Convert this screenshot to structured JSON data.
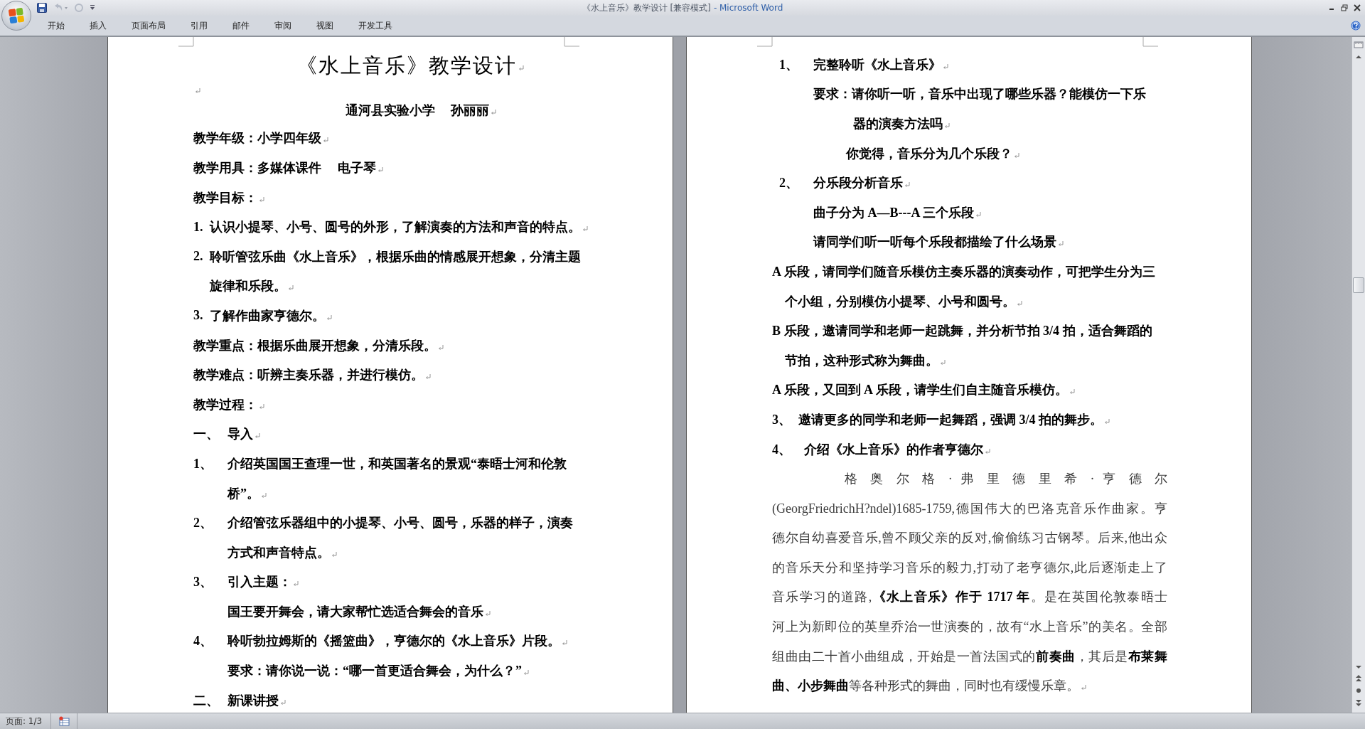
{
  "window": {
    "title": "《水上音乐》教学设计 [兼容模式]",
    "app_name": "- Microsoft Word"
  },
  "ribbon_tabs": [
    {
      "label": "开始",
      "selected": false
    },
    {
      "label": "插入",
      "selected": false
    },
    {
      "label": "页面布局",
      "selected": false
    },
    {
      "label": "引用",
      "selected": false
    },
    {
      "label": "邮件",
      "selected": false
    },
    {
      "label": "审阅",
      "selected": false
    },
    {
      "label": "视图",
      "selected": false
    },
    {
      "label": "开发工具",
      "selected": false
    }
  ],
  "pages": [
    {
      "lines": [
        {
          "kind": "title",
          "text": "《水上音乐》教学设计",
          "mark": true
        },
        {
          "kind": "blank",
          "mark": true
        },
        {
          "kind": "byline",
          "text": "通河县实验小学　 孙丽丽",
          "mark": true
        },
        {
          "kind": "flush",
          "text": "教学年级：小学四年级",
          "mark": true
        },
        {
          "kind": "flush",
          "text": "教学用具：多媒体课件　 电子琴",
          "mark": true
        },
        {
          "kind": "flush",
          "text": "教学目标：",
          "mark": true
        },
        {
          "kind": "list",
          "num": "1.",
          "text": "认识小提琴、小号、圆号的外形，了解演奏的方法和声音的特点。",
          "mark": true
        },
        {
          "kind": "list",
          "num": "2.",
          "text": "聆听管弦乐曲《水上音乐》，根据乐曲的情感展开想象，分清主题",
          "mark": false
        },
        {
          "kind": "hang",
          "text": "旋律和乐段。",
          "mark": true
        },
        {
          "kind": "list",
          "num": "3.",
          "text": "了解作曲家亨德尔。",
          "mark": true
        },
        {
          "kind": "flush",
          "text": "教学重点：根据乐曲展开想象，分清乐段。",
          "mark": true
        },
        {
          "kind": "flush",
          "text": "教学难点：听辨主奏乐器，并进行模仿。",
          "mark": true
        },
        {
          "kind": "flush",
          "text": "教学过程：",
          "mark": true
        },
        {
          "kind": "step",
          "num": "一、",
          "text": "导入",
          "mark": true
        },
        {
          "kind": "step",
          "num": "1、",
          "text": "介绍英国国王查理一世，和英国著名的景观“泰晤士河和伦敦",
          "mark": false
        },
        {
          "kind": "indent",
          "text": "桥”。",
          "mark": true
        },
        {
          "kind": "step",
          "num": "2、",
          "text": "介绍管弦乐器组中的小提琴、小号、圆号，乐器的样子，演奏",
          "mark": false
        },
        {
          "kind": "indent",
          "text": "方式和声音特点。",
          "mark": true
        },
        {
          "kind": "step",
          "num": "3、",
          "text": "引入主题：",
          "mark": true
        },
        {
          "kind": "indent",
          "text": "国王要开舞会，请大家帮忙选适合舞会的音乐",
          "mark": true
        },
        {
          "kind": "step",
          "num": "4、",
          "text": "聆听勃拉姆斯的《摇篮曲》，亨德尔的《水上音乐》片段。",
          "mark": true
        },
        {
          "kind": "indent",
          "text": "要求：请你说一说：“哪一首更适合舞会，为什么？”",
          "mark": true
        },
        {
          "kind": "step",
          "num": "二、",
          "text": "新课讲授",
          "mark": true
        }
      ]
    },
    {
      "lines": [
        {
          "kind": "step-in",
          "num": "1、",
          "text": "完整聆听《水上音乐》",
          "mark": true
        },
        {
          "kind": "sub",
          "text": "要求：请你听一听，音乐中出现了哪些乐器？能模仿一下乐",
          "mark": false
        },
        {
          "kind": "sub-wrap",
          "text": "器的演奏方法吗",
          "mark": true
        },
        {
          "kind": "sub-alt",
          "text": "你觉得，音乐分为几个乐段？",
          "mark": true
        },
        {
          "kind": "step-in",
          "num": "2、",
          "text": "分乐段分析音乐",
          "mark": true
        },
        {
          "kind": "sub",
          "text": "曲子分为 A—B---A 三个乐段",
          "mark": true
        },
        {
          "kind": "sub",
          "text": "请同学们听一听每个乐段都描绘了什么场景",
          "mark": true
        },
        {
          "kind": "flush",
          "text": "A 乐段，请同学们随音乐模仿主奏乐器的演奏动作，可把学生分为三",
          "mark": false
        },
        {
          "kind": "cont",
          "text": "个小组，分别模仿小提琴、小号和圆号。",
          "mark": true
        },
        {
          "kind": "flush",
          "text": "B  乐段，邀请同学和老师一起跳舞，并分析节拍 3/4 拍，适合舞蹈的",
          "mark": false
        },
        {
          "kind": "cont",
          "text": "节拍，这种形式称为舞曲。",
          "mark": true
        },
        {
          "kind": "flush",
          "text": "A  乐段，又回到 A 乐段，请学生们自主随音乐模仿。",
          "mark": true
        },
        {
          "kind": "step-short",
          "num": "3、",
          "text": "邀请更多的同学和老师一起舞蹈，强调 3/4 拍的舞步。",
          "mark": true
        },
        {
          "kind": "step-mid",
          "num": "4、",
          "text": "介绍《水上音乐》的作者亨德尔",
          "mark": true
        },
        {
          "kind": "spread",
          "text": "格 奥 尔 格 · 弗 里 德 里 希 · 亨 德 尔",
          "mark": false
        },
        {
          "kind": "prose",
          "text": "(GeorgFriedrichH?ndel)1685-1759,德国伟大的巴洛克音乐作曲家。亨",
          "mark": false
        },
        {
          "kind": "prose",
          "text": "德尔自幼喜爱音乐,曾不顾父亲的反对,偷偷练习古钢琴。后来,他出众",
          "mark": false
        },
        {
          "kind": "prose",
          "text": "的音乐天分和坚持学习音乐的毅力,打动了老亨德尔,此后逐渐走上了",
          "mark": false
        },
        {
          "kind": "prose",
          "text": "音乐学习的道路,**《水上音乐》作于 1717 年**。是在英国伦敦泰晤士",
          "mark": false
        },
        {
          "kind": "prose",
          "text": "河上为新即位的英皇乔治一世演奏的，故有“水上音乐”的美名。全部",
          "mark": false
        },
        {
          "kind": "prose",
          "text": "组曲由二十首小曲组成，开始是一首法国式的**前奏曲**，其后是**布莱舞**",
          "mark": false
        },
        {
          "kind": "prose-end",
          "text": "**曲、小步舞曲**等各种形式的舞曲，同时也有缓慢乐章。",
          "mark": true
        }
      ]
    }
  ],
  "status_bar": {
    "page": "页面: 1/3"
  }
}
